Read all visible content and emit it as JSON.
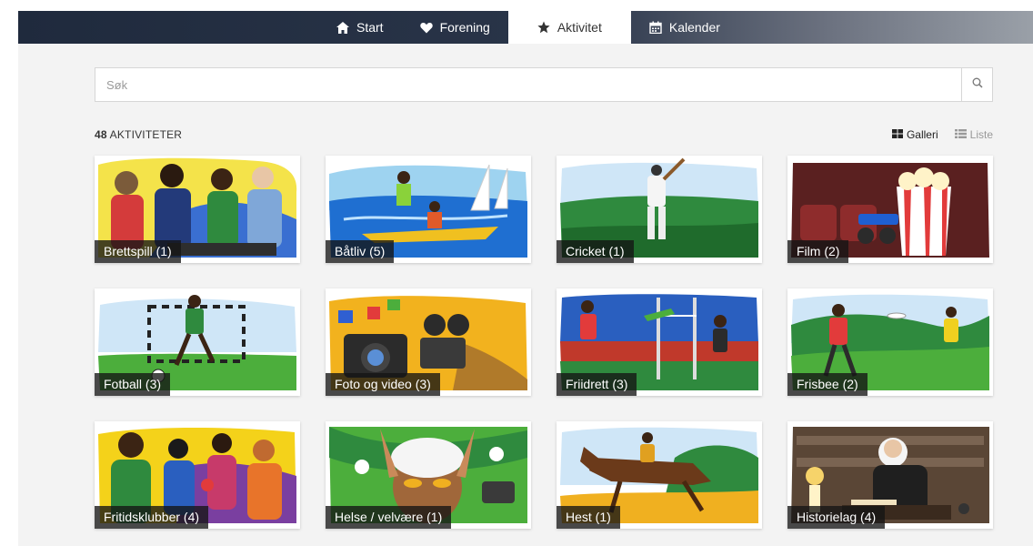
{
  "nav": {
    "tabs": [
      {
        "label": "Start",
        "icon": "home-icon"
      },
      {
        "label": "Forening",
        "icon": "heart-icon"
      },
      {
        "label": "Aktivitet",
        "icon": "star-icon",
        "active": true
      },
      {
        "label": "Kalender",
        "icon": "calendar-icon"
      }
    ]
  },
  "search": {
    "placeholder": "Søk",
    "value": ""
  },
  "results": {
    "count": "48",
    "count_label": "AKTIVITETER"
  },
  "views": {
    "gallery_label": "Galleri",
    "list_label": "Liste",
    "active": "Galleri"
  },
  "activities": [
    {
      "label": "Brettspill (1)"
    },
    {
      "label": "Båtliv (5)"
    },
    {
      "label": "Cricket (1)"
    },
    {
      "label": "Film (2)"
    },
    {
      "label": "Fotball (3)"
    },
    {
      "label": "Foto og video (3)"
    },
    {
      "label": "Friidrett (3)"
    },
    {
      "label": "Frisbee (2)"
    },
    {
      "label": "Fritidsklubber (4)"
    },
    {
      "label": "Helse / velvære (1)"
    },
    {
      "label": "Hest (1)"
    },
    {
      "label": "Historielag (4)"
    }
  ],
  "colors": {
    "topbar": "#1f2a3d",
    "page_bg": "#f3f3f3",
    "label_bg": "#141414"
  }
}
